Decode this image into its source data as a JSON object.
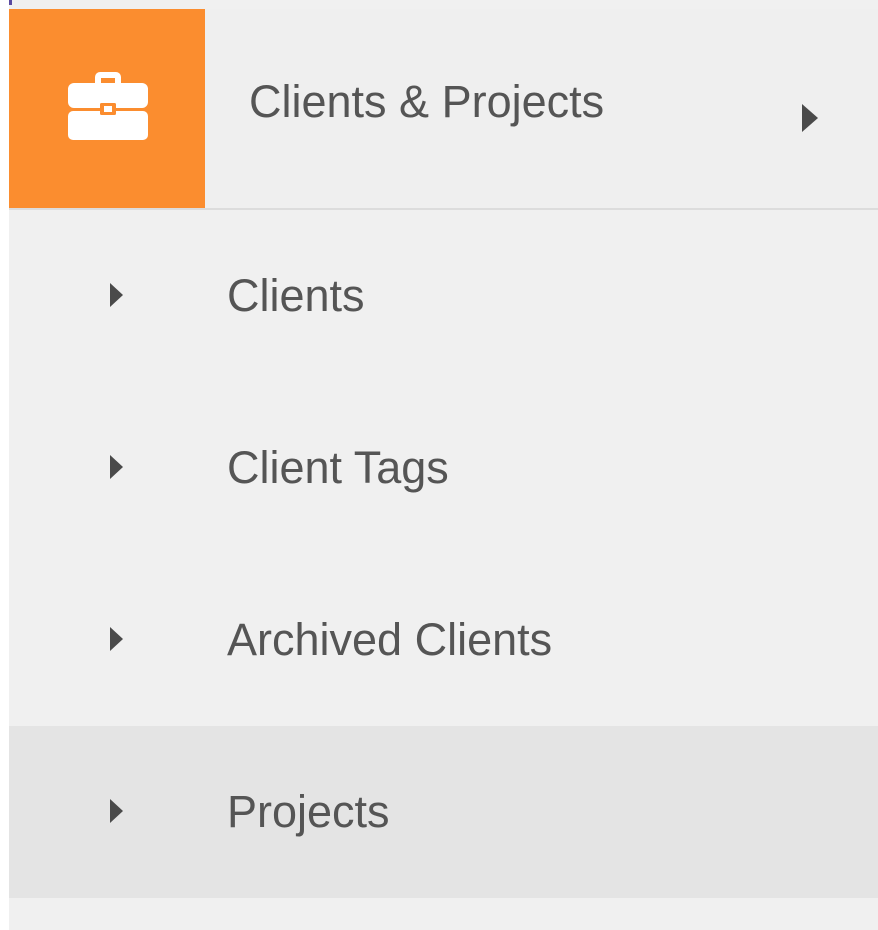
{
  "menu": {
    "header": {
      "icon": "briefcase-icon",
      "label": "Clients & Projects",
      "accent_color": "#fb8d2f",
      "expand_icon": "caret-right-icon"
    },
    "items": [
      {
        "label": "Clients",
        "icon": "caret-right-icon",
        "active": false
      },
      {
        "label": "Client Tags",
        "icon": "caret-right-icon",
        "active": false
      },
      {
        "label": "Archived Clients",
        "icon": "caret-right-icon",
        "active": false
      },
      {
        "label": "Projects",
        "icon": "caret-right-icon",
        "active": true
      }
    ]
  }
}
